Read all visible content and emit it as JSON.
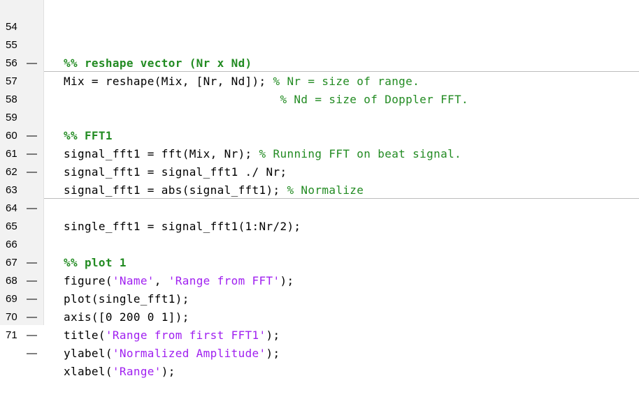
{
  "editor": {
    "lines": [
      {
        "number": "54",
        "breakpoint": "",
        "text": "",
        "comment": "",
        "cell_title": "%% reshape vector (Nr x Nd)"
      },
      {
        "number": "55",
        "breakpoint": "—",
        "text": "Mix = reshape(Mix, [Nr, Nd]); ",
        "comment": "% Nr = size of range."
      },
      {
        "number": "56",
        "breakpoint": "",
        "text": "                               ",
        "comment": "% Nd = size of Doppler FFT."
      },
      {
        "number": "57",
        "breakpoint": "",
        "text": ""
      },
      {
        "number": "58",
        "breakpoint": "",
        "cell_title": "%% FFT1"
      },
      {
        "number": "59",
        "breakpoint": "—",
        "text": "signal_fft1 = fft(Mix, Nr); ",
        "comment": "% Running FFT on beat signal."
      },
      {
        "number": "60",
        "breakpoint": "—",
        "text": "signal_fft1 = signal_fft1 ./ Nr;"
      },
      {
        "number": "61",
        "breakpoint": "—",
        "text": "signal_fft1 = abs(signal_fft1); ",
        "comment": "% Normalize"
      },
      {
        "number": "62",
        "breakpoint": "",
        "text": ""
      },
      {
        "number": "63",
        "breakpoint": "—",
        "text": "single_fft1 = signal_fft1(1:Nr/2);"
      },
      {
        "number": "64",
        "breakpoint": "",
        "text": ""
      },
      {
        "number": "65",
        "breakpoint": "",
        "cell_title": "%% plot 1"
      },
      {
        "number": "66",
        "breakpoint": "—",
        "pre": "figure(",
        "str1": "'Name'",
        "mid": ", ",
        "str2": "'Range from FFT'",
        "post": ");"
      },
      {
        "number": "67",
        "breakpoint": "—",
        "text": "plot(single_fft1);"
      },
      {
        "number": "68",
        "breakpoint": "—",
        "text": "axis([0 200 0 1]);"
      },
      {
        "number": "69",
        "breakpoint": "—",
        "pre": "title(",
        "str1": "'Range from first FFT1'",
        "post": ");"
      },
      {
        "number": "70",
        "breakpoint": "—",
        "pre": "ylabel(",
        "str1": "'Normalized Amplitude'",
        "post": ");"
      },
      {
        "number": "71",
        "breakpoint": "—",
        "pre": "xlabel(",
        "str1": "'Range'",
        "post": ");"
      }
    ]
  },
  "colors": {
    "comment": "#228b22",
    "string": "#a020f0",
    "gutter_bg": "#f2f2f2",
    "cell_divider": "#bdbdbd"
  }
}
